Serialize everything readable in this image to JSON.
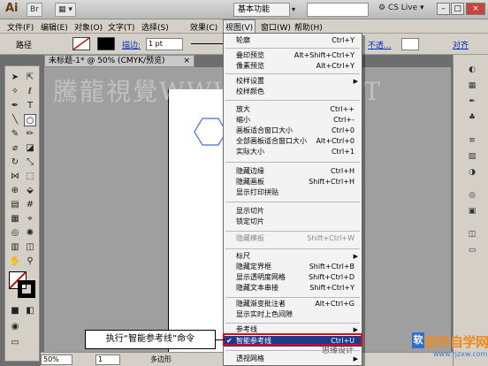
{
  "titlebar": {
    "app_logo": "Ai",
    "workspace": "基本功能",
    "cs_live": "CS Live",
    "min": "–",
    "max": "□",
    "close": "×"
  },
  "menubar": {
    "items": [
      {
        "label": "文件(F)"
      },
      {
        "label": "编辑(E)"
      },
      {
        "label": "对象(O)"
      },
      {
        "label": "文字(T)"
      },
      {
        "label": "选择(S)"
      },
      {
        "label": "效果(C)"
      },
      {
        "label": "视图(V)"
      },
      {
        "label": "窗口(W)"
      },
      {
        "label": "帮助(H)"
      }
    ]
  },
  "controlbar": {
    "path_label": "路径",
    "stroke_label": "描边:",
    "stroke_value": "1 pt",
    "opacity_label": "不透...",
    "align_label": "对齐"
  },
  "document": {
    "tab_title": "未标题-1* @ 50% (CMYK/预览)",
    "close": "×"
  },
  "watermark": "騰龍視覺WWW.TLVI.NET",
  "status": {
    "zoom": "50%",
    "page": "1",
    "info": "多边形"
  },
  "view_menu": {
    "items": [
      {
        "label": "轮廓",
        "shortcut": "Ctrl+Y"
      },
      {
        "label": "叠印预览",
        "shortcut": "Alt+Shift+Ctrl+Y"
      },
      {
        "label": "像素预览",
        "shortcut": "Alt+Ctrl+Y"
      },
      {
        "label": "校样设置",
        "submenu": "▶"
      },
      {
        "label": "校样颜色"
      },
      {
        "label": "放大",
        "shortcut": "Ctrl++"
      },
      {
        "label": "缩小",
        "shortcut": "Ctrl+-"
      },
      {
        "label": "画板适合窗口大小",
        "shortcut": "Ctrl+0"
      },
      {
        "label": "全部画板适合窗口大小",
        "shortcut": "Alt+Ctrl+0"
      },
      {
        "label": "实际大小",
        "shortcut": "Ctrl+1"
      },
      {
        "label": "隐藏边缘",
        "shortcut": "Ctrl+H"
      },
      {
        "label": "隐藏画板",
        "shortcut": "Shift+Ctrl+H"
      },
      {
        "label": "显示打印拼贴"
      },
      {
        "label": "显示切片"
      },
      {
        "label": "锁定切片"
      },
      {
        "label": "隐藏模板",
        "shortcut": "Shift+Ctrl+W",
        "disabled": true
      },
      {
        "label": "标尺",
        "submenu": "▶"
      },
      {
        "label": "隐藏定界框",
        "shortcut": "Shift+Ctrl+B"
      },
      {
        "label": "显示透明度网格",
        "shortcut": "Shift+Ctrl+D"
      },
      {
        "label": "隐藏文本串接",
        "shortcut": "Shift+Ctrl+Y"
      },
      {
        "label": "隐藏渐变批注者",
        "shortcut": "Alt+Ctrl+G"
      },
      {
        "label": "显示实时上色间隙"
      },
      {
        "label": "参考线",
        "submenu": "▶"
      },
      {
        "label": "智能参考线",
        "shortcut": "Ctrl+U",
        "checked": "✔"
      },
      {
        "label": "透视网格",
        "submenu": "▶"
      }
    ]
  },
  "callout": "执行“智能参考线”命令",
  "site_logo": {
    "badge": "软",
    "title": "软件自学网",
    "url": "www.rjzxw.com"
  },
  "design_watermark": "思缘设计",
  "colors": {
    "menu_highlight": "#1e3a8c",
    "callout_border": "#e0001a"
  }
}
